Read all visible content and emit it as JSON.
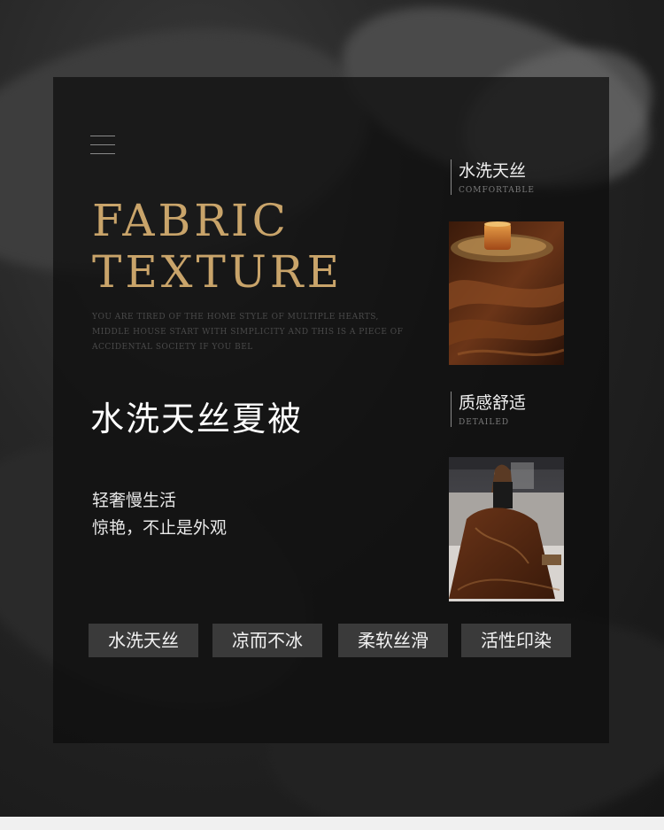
{
  "hero": {
    "title_line1": "FABRIC",
    "title_line2": "TEXTURE",
    "blurb": "YOU ARE TIRED OF THE HOME STYLE OF MULTIPLE HEARTS, MIDDLE HOUSE START WITH SIMPLICITY AND THIS IS A PIECE OF ACCIDENTAL SOCIETY IF YOU BEL",
    "main_title": "水洗天丝夏被",
    "subtitle_line1": "轻奢慢生活",
    "subtitle_line2": "惊艳，不止是外观"
  },
  "tags": [
    "水洗天丝",
    "凉而不冰",
    "柔软丝滑",
    "活性印染"
  ],
  "sidebar": {
    "items": [
      {
        "cn": "水洗天丝",
        "en": "COMFORTABLE"
      },
      {
        "cn": "质感舒适",
        "en": "DETAILED"
      }
    ]
  },
  "colors": {
    "gold": "#c9a46a",
    "panel": "#0c0c0c",
    "tag_bg": "#3a3a3a",
    "fabric_brown": "#5a2c14"
  },
  "icons": [
    "menu-icon"
  ]
}
